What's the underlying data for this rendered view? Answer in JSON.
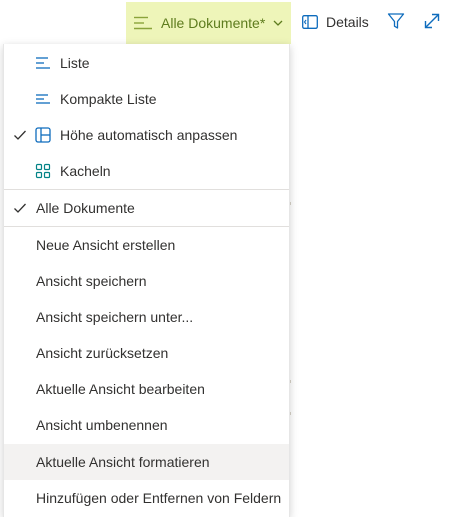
{
  "toolbar": {
    "view_name": "Alle Dokumente*",
    "details_label": "Details",
    "accent_color": "#eef5b9",
    "icons": [
      "list-lines-icon",
      "chevron-down-icon",
      "details-pane-icon",
      "filter-icon",
      "expand-icon"
    ]
  },
  "menu": {
    "layout_options": [
      {
        "label": "Liste",
        "icon": "list-icon",
        "checked": false
      },
      {
        "label": "Kompakte Liste",
        "icon": "compact-list-icon",
        "checked": false
      },
      {
        "label": "Höhe automatisch anpassen",
        "icon": "autofit-height-icon",
        "checked": true
      },
      {
        "label": "Kacheln",
        "icon": "tiles-icon",
        "checked": false
      }
    ],
    "views": [
      {
        "label": "Alle Dokumente",
        "checked": true
      }
    ],
    "actions": [
      {
        "label": "Neue Ansicht erstellen"
      },
      {
        "label": "Ansicht speichern"
      },
      {
        "label": "Ansicht speichern unter..."
      },
      {
        "label": "Ansicht zurücksetzen"
      },
      {
        "label": "Aktuelle Ansicht bearbeiten"
      },
      {
        "label": "Ansicht umbenennen"
      },
      {
        "label": "Aktuelle Ansicht formatieren",
        "highlighted": true
      },
      {
        "label": "Hinzufügen oder Entfernen von Feldern"
      }
    ]
  }
}
